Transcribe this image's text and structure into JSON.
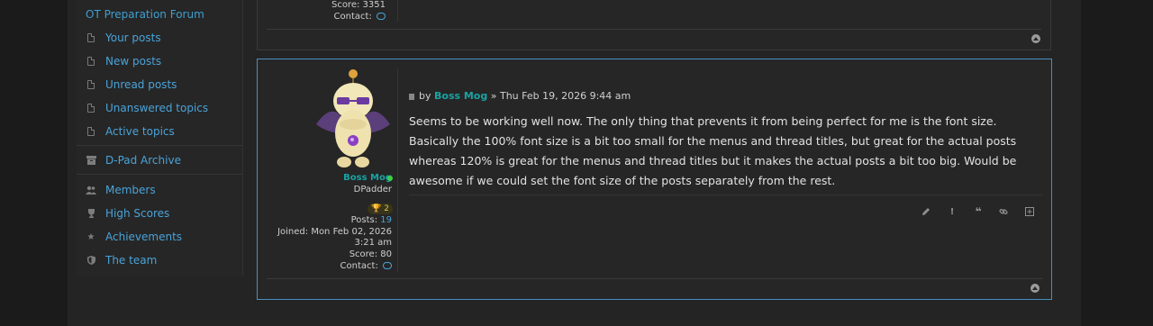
{
  "sidebar": {
    "forum_link": "OT Preparation Forum",
    "items": [
      {
        "label": "Your posts",
        "icon": "document-icon"
      },
      {
        "label": "New posts",
        "icon": "document-icon"
      },
      {
        "label": "Unread posts",
        "icon": "document-icon"
      },
      {
        "label": "Unanswered topics",
        "icon": "document-icon"
      },
      {
        "label": "Active topics",
        "icon": "document-icon"
      },
      {
        "label": "D-Pad Archive",
        "icon": "archive-icon"
      },
      {
        "label": "Members",
        "icon": "users-icon"
      },
      {
        "label": "High Scores",
        "icon": "trophy-icon"
      },
      {
        "label": "Achievements",
        "icon": "star-icon"
      },
      {
        "label": "The team",
        "icon": "shield-icon"
      }
    ]
  },
  "previous_post": {
    "score_label": "Score:",
    "score_value": "3351",
    "contact_label": "Contact:"
  },
  "post": {
    "by_label": "by",
    "author": "Boss Mog",
    "separator": "»",
    "timestamp": "Thu Feb 19, 2026 9:44 am",
    "rank": "DPadder",
    "trophy_count": "2",
    "posts_label": "Posts:",
    "posts_value": "19",
    "joined_label": "Joined:",
    "joined_value_1": "Mon Feb 02, 2026",
    "joined_value_2": "3:21 am",
    "score_label": "Score:",
    "score_value": "80",
    "contact_label": "Contact:",
    "body": "Seems to be working well now. The only thing that prevents it from being perfect for me is the font size. Basically the 100% font size is a bit too small for the menus and thread titles, but great for the actual posts whereas 120% is great for the menus and thread titles but it makes the actual posts a bit too big. Would be awesome if we could set the font size of the posts separately from the rest."
  },
  "colors": {
    "accent": "#4aa3d8",
    "username": "#1aa3a3",
    "online": "#3ed04a",
    "post_border": "#4a8fbf"
  }
}
